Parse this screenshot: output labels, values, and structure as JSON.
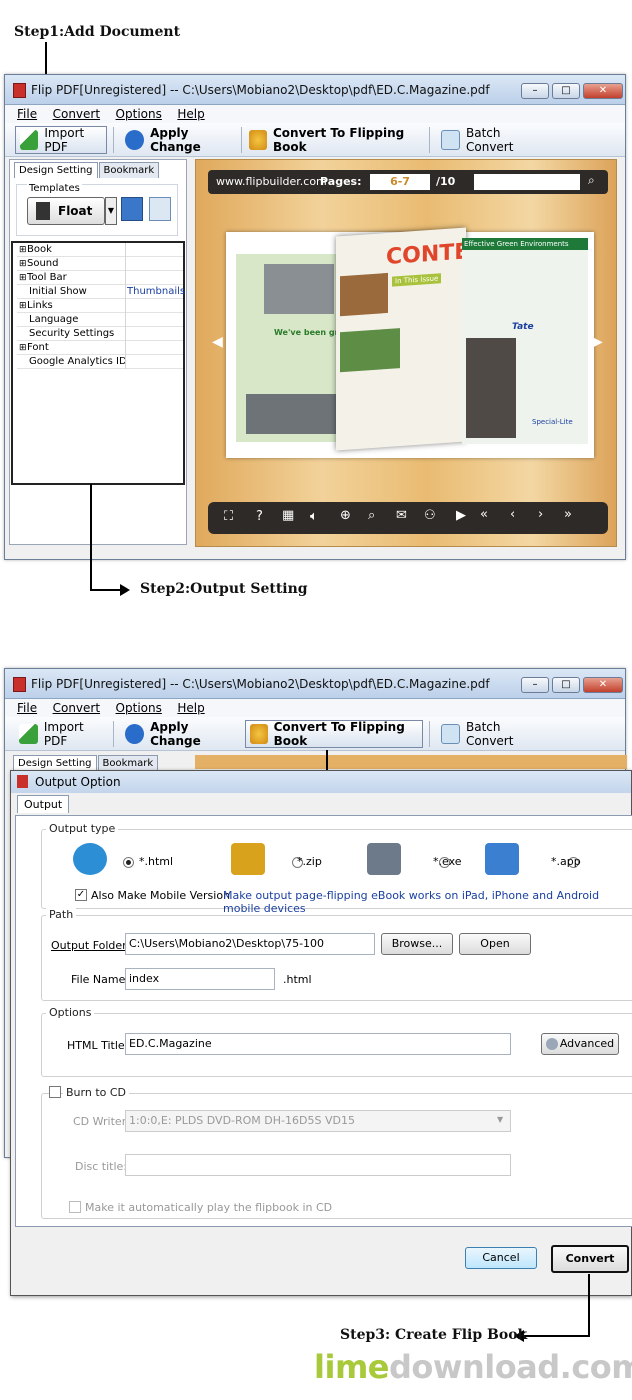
{
  "steps": {
    "step1": "Step1:Add Document",
    "step2": "Step2:Output Setting",
    "step3": "Step3: Create Flip Book"
  },
  "window": {
    "title": "Flip PDF[Unregistered] -- C:\\Users\\Mobiano2\\Desktop\\pdf\\ED.C.Magazine.pdf",
    "controls": {
      "minimize": "–",
      "maximize": "□",
      "close": "✕"
    }
  },
  "menu": {
    "file": "File",
    "convert": "Convert",
    "options": "Options",
    "help": "Help"
  },
  "toolbar": {
    "import_pdf": "Import PDF",
    "apply_change": "Apply Change",
    "convert_to_flipping_book": "Convert To Flipping Book",
    "batch_convert": "Batch Convert"
  },
  "panel": {
    "tabs": [
      "Design Setting",
      "Bookmark"
    ],
    "templates_label": "Templates",
    "template_value": "Float",
    "properties": [
      {
        "key": "Book",
        "value": "",
        "expandable": true
      },
      {
        "key": "Sound",
        "value": "",
        "expandable": true
      },
      {
        "key": "Tool Bar",
        "value": "",
        "expandable": true
      },
      {
        "key": "Initial Show",
        "value": "Thumbnails",
        "expandable": false
      },
      {
        "key": "Links",
        "value": "",
        "expandable": true
      },
      {
        "key": "Language",
        "value": "",
        "expandable": false
      },
      {
        "key": "Security Settings",
        "value": "",
        "expandable": false
      },
      {
        "key": "Font",
        "value": "",
        "expandable": true
      },
      {
        "key": "Google Analytics ID",
        "value": "",
        "expandable": false
      }
    ]
  },
  "preview": {
    "site": "www.flipbuilder.com",
    "pages_label": "Pages:",
    "current_pages": "6-7",
    "total_pages": "/10",
    "magazine_heading": "CONTE",
    "page_texts": [
      "We've been green",
      "Effective Green Environments",
      "In This Issue",
      "Tate",
      "Special-Lite"
    ]
  },
  "output_dialog": {
    "title": "Output Option",
    "tab": "Output",
    "output_type_label": "Output type",
    "types": [
      {
        "label": "*.html",
        "selected": true,
        "icon": "globe-icon"
      },
      {
        "label": "*.zip",
        "selected": false,
        "icon": "zip-archive-icon"
      },
      {
        "label": "*.exe",
        "selected": false,
        "icon": "exe-gear-icon"
      },
      {
        "label": "*.app",
        "selected": false,
        "icon": "mac-finder-icon"
      }
    ],
    "mobile_checkbox": "Also Make Mobile Version",
    "mobile_note": "Make output page-flipping eBook works on iPad, iPhone and Android mobile devices",
    "path_label": "Path",
    "output_folder_label": "Output Folder:",
    "output_folder_value": "C:\\Users\\Mobiano2\\Desktop\\75-100",
    "browse": "Browse...",
    "open": "Open",
    "file_name_label": "File Name:",
    "file_name_value": "index",
    "file_ext": ".html",
    "options_label": "Options",
    "html_title_label": "HTML Title:",
    "html_title_value": "ED.C.Magazine",
    "advanced": "Advanced",
    "burn_label": "Burn to CD",
    "cd_writer_label": "CD Writer:",
    "cd_writer_value": "1:0:0,E: PLDS    DVD-ROM DH-16D5S VD15",
    "disc_title_label": "Disc title:",
    "autoplay_label": "Make it automatically play the flipbook in CD",
    "cancel": "Cancel",
    "convert": "Convert"
  },
  "watermark": {
    "part1": "lime",
    "part2": "download",
    "part3": ".com"
  },
  "colors": {
    "accent": "#1a3fa0",
    "lime": "#a8c93a",
    "wood": "#e9bb72",
    "dark_toolbar": "#2e2a27"
  }
}
